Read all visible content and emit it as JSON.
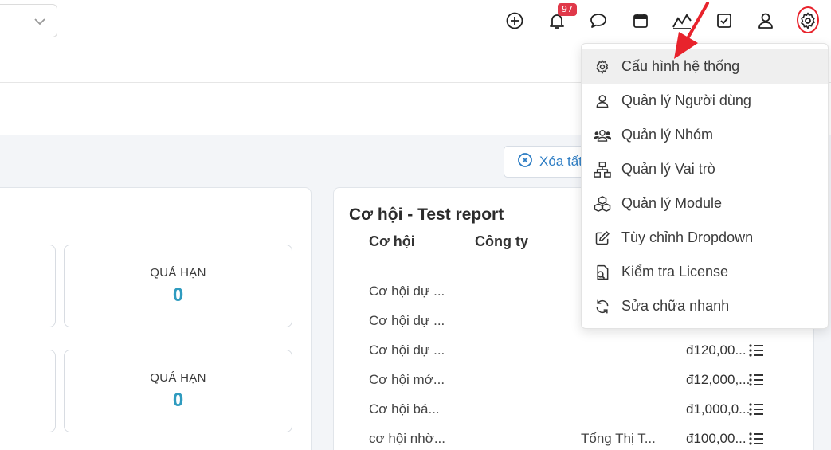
{
  "header": {
    "notification_count": "97",
    "icons": [
      "add-circle-icon",
      "bell-icon",
      "chat-icon",
      "calendar-icon",
      "chart-line-icon",
      "checkbox-icon",
      "user-icon",
      "gear-icon"
    ]
  },
  "toolbar": {
    "clear_filter_label": "Xóa tất"
  },
  "stats": {
    "card1": {
      "label": "QUÁ HẠN",
      "value": "0"
    },
    "card2": {
      "label": "QUÁ HẠN",
      "value": "0"
    }
  },
  "report": {
    "title": "Cơ hội - Test report",
    "columns": [
      "Cơ hội",
      "Công ty"
    ],
    "rows": [
      {
        "name": "Cơ hội dự ...",
        "company": "",
        "amount": ""
      },
      {
        "name": "Cơ hội dự ...",
        "company": "",
        "amount": ""
      },
      {
        "name": "Cơ hội dự ...",
        "company": "",
        "amount": "đ120,00..."
      },
      {
        "name": "Cơ hội mớ...",
        "company": "",
        "amount": "đ12,000,..."
      },
      {
        "name": "Cơ hội bá...",
        "company": "",
        "amount": "đ1,000,0..."
      },
      {
        "name": "cơ hội nhờ...",
        "company": "Tống Thị T...",
        "amount": "đ100,00..."
      }
    ]
  },
  "settings_menu": {
    "items": [
      {
        "label": "Cấu hình hệ thống",
        "icon": "gear-icon"
      },
      {
        "label": "Quản lý Người dùng",
        "icon": "user-icon"
      },
      {
        "label": "Quản lý Nhóm",
        "icon": "group-icon"
      },
      {
        "label": "Quản lý Vai trò",
        "icon": "hierarchy-icon"
      },
      {
        "label": "Quản lý Module",
        "icon": "boxes-icon"
      },
      {
        "label": "Tùy chỉnh Dropdown",
        "icon": "edit-icon"
      },
      {
        "label": "Kiểm tra License",
        "icon": "license-icon"
      },
      {
        "label": "Sửa chữa nhanh",
        "icon": "refresh-icon"
      }
    ]
  },
  "colors": {
    "accent_line": "#e07b4f",
    "badge": "#e0394a",
    "stat_value": "#2f9bbf",
    "highlight_ring": "#e8232c"
  }
}
